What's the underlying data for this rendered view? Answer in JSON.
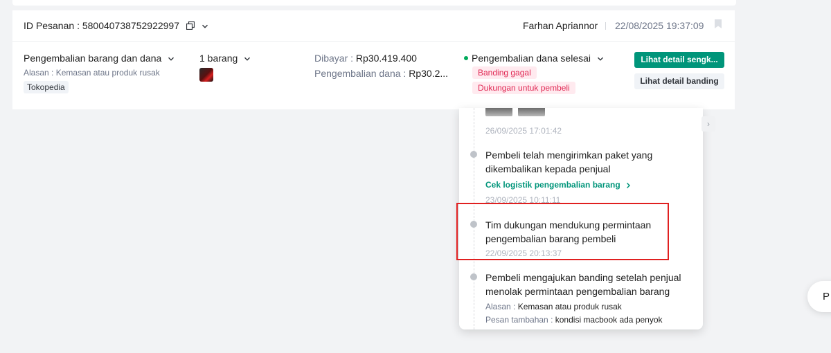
{
  "order": {
    "id_label": "ID Pesanan",
    "id_value": "580040738752922997",
    "buyer_name": "Farhan Apriannor",
    "datetime": "22/08/2025 19:37:09"
  },
  "return_request": {
    "type": "Pengembalian barang dan dana",
    "reason_label": "Alasan",
    "reason_value": "Kemasan atau produk rusak",
    "platform_tag": "Tokopedia",
    "quantity": "1 barang"
  },
  "payment": {
    "paid_label": "Dibayar",
    "paid_value": "Rp30.419.400",
    "refund_label": "Pengembalian dana",
    "refund_value": "Rp30.2..."
  },
  "status": {
    "label": "Pengembalian dana selesai",
    "color": "#00aa5b",
    "badges": [
      "Banding gagal",
      "Dukungan untuk pembeli"
    ]
  },
  "actions": {
    "primary_label": "Lihat detail sengk...",
    "secondary_label": "Lihat detail banding"
  },
  "timeline": {
    "events": [
      {
        "timestamp": "26/09/2025 17:01:42"
      },
      {
        "title": "Pembeli telah mengirimkan paket yang dikembalikan kepada penjual",
        "link": "Cek logistik pengembalian barang",
        "timestamp": "23/09/2025 10:11:11"
      },
      {
        "title": "Tim dukungan mendukung permintaan pengembalian barang pembeli",
        "timestamp": "22/09/2025 20:13:37"
      },
      {
        "title": "Pembeli mengajukan banding setelah penjual menolak permintaan pengembalian barang",
        "reason_label": "Alasan",
        "reason_value": "Kemasan atau produk rusak",
        "note_label": "Pesan tambahan",
        "note_value": "kondisi macbook ada penyok"
      }
    ]
  },
  "floating_button": {
    "label": "P"
  },
  "colors": {
    "accent": "#00957a",
    "danger": "#e02954",
    "highlight": "#e02020",
    "background": "#f2f3f5"
  }
}
